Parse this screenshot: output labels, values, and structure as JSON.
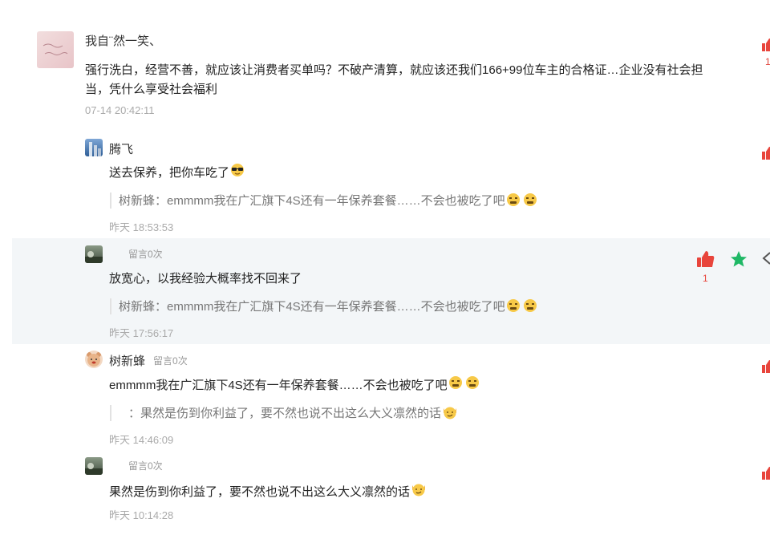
{
  "comments": [
    {
      "username": "我自¨然一笑、",
      "text_line1": "强行洗白，经营不善，就应该让消费者买单吗？不破产清算，就应该还我们166+99位车主的合格证…企业没有社会担",
      "text_line2": "当，凭什么享受社会福利",
      "time": "07-14 20:42:11",
      "like_count": "1"
    },
    {
      "username": "腾飞",
      "text": "送去保养，把你车吃了",
      "quote": "树新蜂：emmmm我在广汇旗下4S还有一年保养套餐……不会也被吃了吧",
      "time": "昨天 18:53:53"
    },
    {
      "username": "",
      "badge": "留言0次",
      "text": "放宽心，以我经验大概率找不回来了",
      "quote": "树新蜂：emmmm我在广汇旗下4S还有一年保养套餐……不会也被吃了吧",
      "time": "昨天 17:56:17",
      "like_count": "1"
    },
    {
      "username": "树新蜂",
      "badge": "留言0次",
      "text": "emmmm我在广汇旗下4S还有一年保养套餐……不会也被吃了吧",
      "quote": "：果然是伤到你利益了，要不然也说不出这么大义凛然的话",
      "time": "昨天 14:46:09"
    },
    {
      "username": "",
      "badge": "留言0次",
      "text": "果然是伤到你利益了，要不然也说不出这么大义凛然的话",
      "time": "昨天 10:14:28"
    }
  ],
  "colors": {
    "like": "#e8453c",
    "star": "#1fb866",
    "highlight_bg": "#f3f6f8"
  },
  "icons": [
    "thumbs-up-icon",
    "star-icon",
    "share-icon"
  ]
}
